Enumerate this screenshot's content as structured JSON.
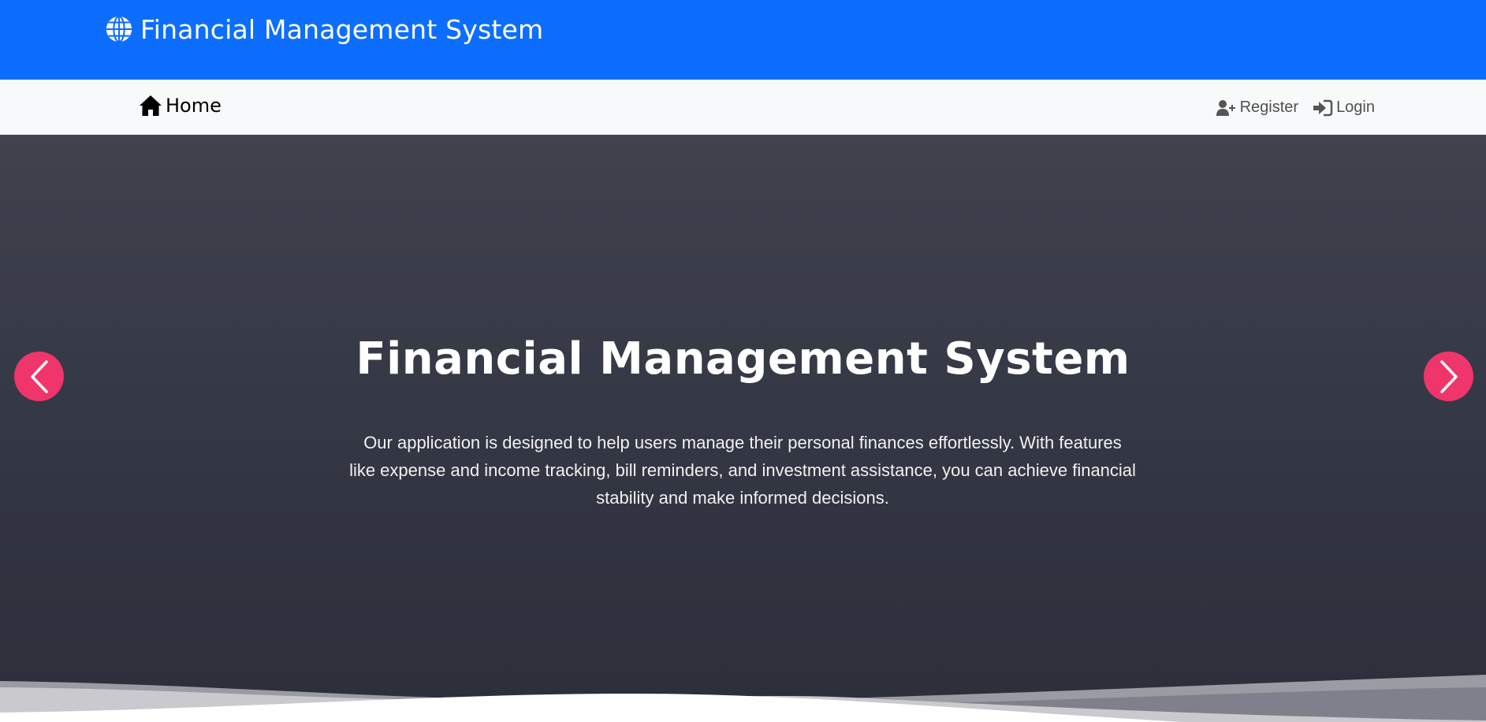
{
  "header": {
    "brand_title": "Financial Management System",
    "brand_icon": "globe-icon",
    "background_color": "#0d6efd"
  },
  "navbar": {
    "home_label": "Home",
    "home_icon": "home-icon",
    "register_label": "Register",
    "register_icon": "user-plus-icon",
    "login_label": "Login",
    "login_icon": "sign-in-icon"
  },
  "hero": {
    "title": "Financial Management System",
    "description": "Our application is designed to help users manage their personal finances effortlessly. With features like expense and income tracking, bill reminders, and investment assistance, you can achieve financial stability and make informed decisions.",
    "prev_icon": "chevron-left-icon",
    "next_icon": "chevron-right-icon",
    "accent_color": "#f0356b"
  }
}
